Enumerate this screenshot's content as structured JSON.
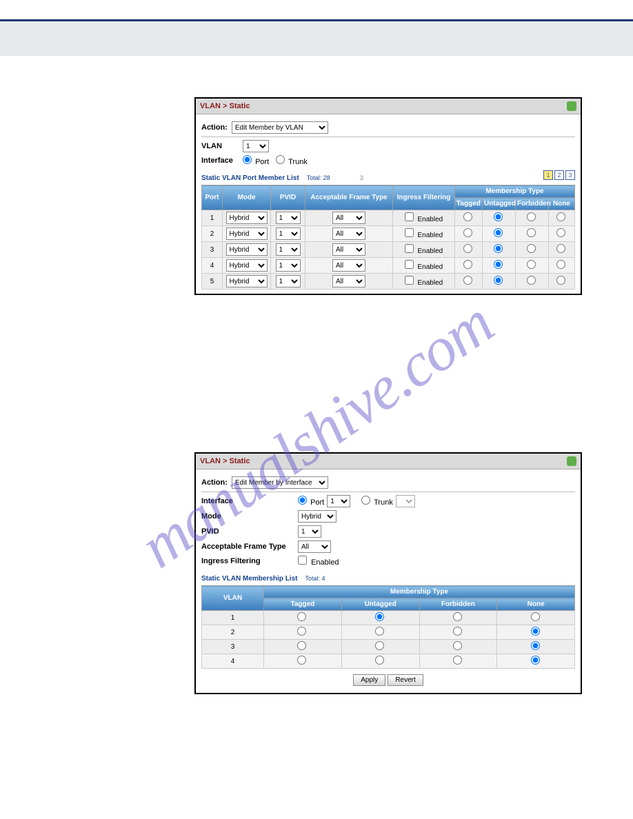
{
  "watermark": "manualshive.com",
  "panel1": {
    "title": "VLAN > Static",
    "action_label": "Action:",
    "action_value": "Edit Member by VLAN",
    "vlan_label": "VLAN",
    "vlan_value": "1",
    "interface_label": "Interface",
    "interface_opts": {
      "port": "Port",
      "trunk": "Trunk"
    },
    "interface_selected": "port",
    "list_title": "Static VLAN Port Member List",
    "total_label": "Total: 28",
    "extra_num": "3",
    "pager": [
      "1",
      "2",
      "3"
    ],
    "active_page": "1",
    "columns": {
      "port": "Port",
      "mode": "Mode",
      "pvid": "PVID",
      "aft": "Acceptable Frame Type",
      "ingress": "Ingress Filtering",
      "mt": "Membership Type",
      "tagged": "Tagged",
      "untagged": "Untagged",
      "forbidden": "Forbidden",
      "none": "None"
    },
    "enabled_label": "Enabled",
    "rows": [
      {
        "port": "1",
        "mode": "Hybrid",
        "pvid": "1",
        "aft": "All",
        "enabled": false,
        "mt": "untagged"
      },
      {
        "port": "2",
        "mode": "Hybrid",
        "pvid": "1",
        "aft": "All",
        "enabled": false,
        "mt": "untagged"
      },
      {
        "port": "3",
        "mode": "Hybrid",
        "pvid": "1",
        "aft": "All",
        "enabled": false,
        "mt": "untagged"
      },
      {
        "port": "4",
        "mode": "Hybrid",
        "pvid": "1",
        "aft": "All",
        "enabled": false,
        "mt": "untagged"
      },
      {
        "port": "5",
        "mode": "Hybrid",
        "pvid": "1",
        "aft": "All",
        "enabled": false,
        "mt": "untagged"
      }
    ]
  },
  "panel2": {
    "title": "VLAN > Static",
    "action_label": "Action:",
    "action_value": "Edit Member by Interface",
    "interface_label": "Interface",
    "port_label": "Port",
    "port_value": "1",
    "trunk_label": "Trunk",
    "mode_label": "Mode",
    "mode_value": "Hybrid",
    "pvid_label": "PVID",
    "pvid_value": "1",
    "aft_label": "Acceptable Frame Type",
    "aft_value": "All",
    "ingress_label": "Ingress Filtering",
    "enabled_label": "Enabled",
    "list_title": "Static VLAN Membership List",
    "total_label": "Total: 4",
    "columns": {
      "vlan": "VLAN",
      "mt": "Membership Type",
      "tagged": "Tagged",
      "untagged": "Untagged",
      "forbidden": "Forbidden",
      "none": "None"
    },
    "rows": [
      {
        "vlan": "1",
        "mt": "untagged"
      },
      {
        "vlan": "2",
        "mt": "none"
      },
      {
        "vlan": "3",
        "mt": "none"
      },
      {
        "vlan": "4",
        "mt": "none"
      }
    ],
    "buttons": {
      "apply": "Apply",
      "revert": "Revert"
    }
  }
}
